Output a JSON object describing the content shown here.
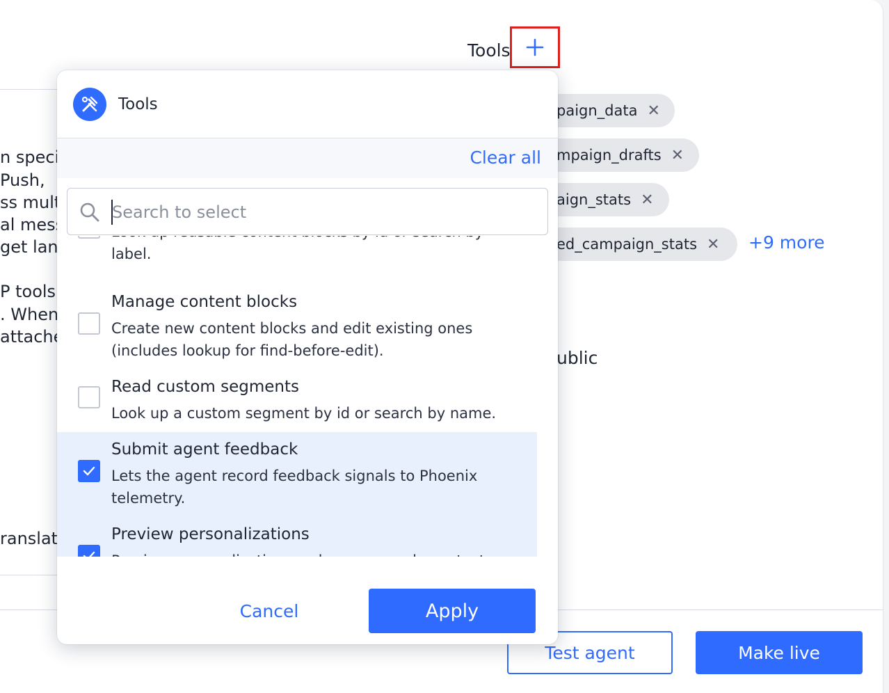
{
  "background": {
    "left_text_lines": [
      "n speci",
      " Push,",
      "ss mult",
      "al mess",
      "get lang",
      "P tools.",
      ". When",
      "attache",
      "ranslat"
    ],
    "tools_label": "Tools",
    "chips": [
      {
        "label": "paign_data"
      },
      {
        "label": "mpaign_drafts"
      },
      {
        "label": "aign_stats"
      },
      {
        "label": "ed_campaign_stats"
      }
    ],
    "chip_remove_glyph": "✕",
    "more_link": "+9 more",
    "public_text": "ublic",
    "test_agent_label": "Test agent",
    "make_live_label": "Make live"
  },
  "popover": {
    "title": "Tools",
    "clear_all": "Clear all",
    "search_placeholder": "Search to select",
    "items": [
      {
        "title": "",
        "desc": "Look up reusable content blocks by id or search by label.",
        "checked": false
      },
      {
        "title": "Manage content blocks",
        "desc": "Create new content blocks and edit existing ones (includes lookup for find-before-edit).",
        "checked": false
      },
      {
        "title": "Read custom segments",
        "desc": "Look up a custom segment by id or search by name.",
        "checked": false
      },
      {
        "title": "Submit agent feedback",
        "desc": "Lets the agent record feedback signals to Phoenix telemetry.",
        "checked": true
      },
      {
        "title": "Preview personalizations",
        "desc": "Preview personalization renders on sample contacts.",
        "checked": true
      }
    ],
    "cancel_label": "Cancel",
    "apply_label": "Apply"
  },
  "colors": {
    "accent": "#2f6bff",
    "highlight": "#e11d1d",
    "selected_row": "#e8f0fe"
  },
  "icons": {
    "add": "plus-icon",
    "tools": "tools-icon",
    "search": "search-icon",
    "check": "check-icon"
  }
}
